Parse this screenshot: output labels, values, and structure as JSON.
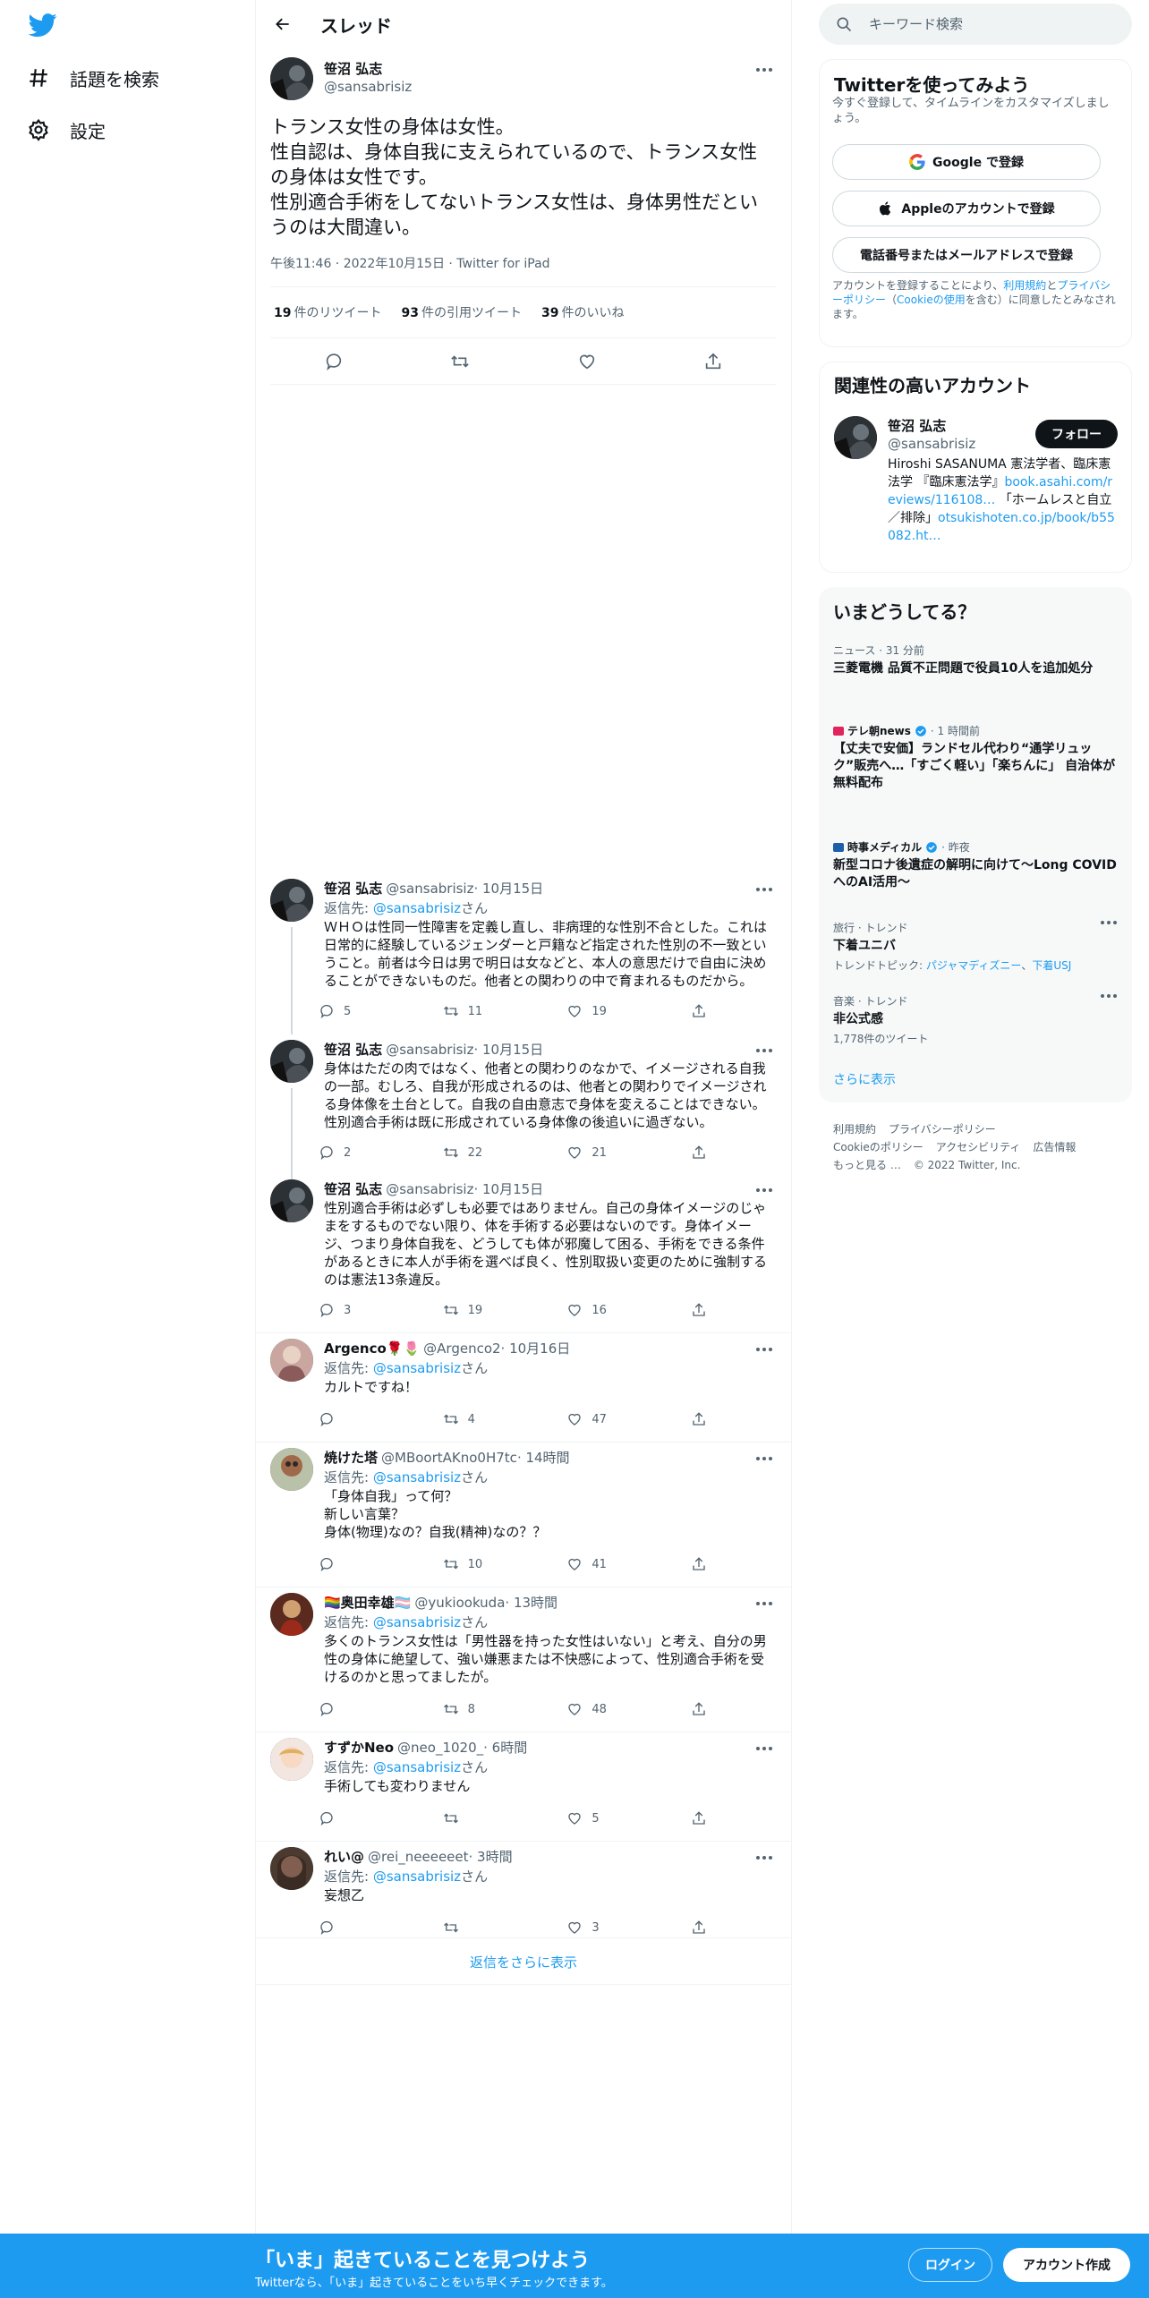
{
  "colors": {
    "brand": "#1d9bf0",
    "text": "#0f1419",
    "muted": "#536471",
    "border": "#eff3f4"
  },
  "nav": {
    "explore": "話題を検索",
    "settings": "設定"
  },
  "header": {
    "title": "スレッド"
  },
  "focal": {
    "name": "笹沼 弘志",
    "handle": "@sansabrisiz",
    "text": "トランス女性の身体は女性。\n性自認は、身体自我に支えられているので、トランス女性の身体は女性です。\n性別適合手術をしてないトランス女性は、身体男性だというのは大間違い。",
    "meta": "午後11:46 · 2022年10月15日 · Twitter for iPad",
    "retweets": "19",
    "retweets_label": "件のリツイート",
    "quotes": "93",
    "quotes_label": "件の引用ツイート",
    "likes": "39",
    "likes_label": "件のいいね"
  },
  "reply_prefix": "返信先: ",
  "reply_suffix": "さん",
  "tweets": [
    {
      "name": "笹沼 弘志",
      "handle": "@sansabrisiz",
      "time": " · 10月15日",
      "reply_to": "@sansabrisiz",
      "text": "ＷＨＯは性同一性障害を定義し直し、非病理的な性別不合とした。これは日常的に経験しているジェンダーと戸籍など指定された性別の不一致ということ。前者は今日は男で明日は女などと、本人の意思だけで自由に決めることができないものだ。他者との関わりの中で育まれるものだから。",
      "replies": "5",
      "retweets": "11",
      "likes": "19"
    },
    {
      "name": "笹沼 弘志",
      "handle": "@sansabrisiz",
      "time": " · 10月15日",
      "text": "身体はただの肉ではなく、他者との関わりのなかで、イメージされる自我の一部。むしろ、自我が形成されるのは、他者との関わりでイメージされる身体像を土台として。自我の自由意志で身体を変えることはできない。性別適合手術は既に形成されている身体像の後追いに過ぎない。",
      "replies": "2",
      "retweets": "22",
      "likes": "21"
    },
    {
      "name": "笹沼 弘志",
      "handle": "@sansabrisiz",
      "time": " · 10月15日",
      "text": "性別適合手術は必ずしも必要ではありません。自己の身体イメージのじゃまをするものでない限り、体を手術する必要はないのです。身体イメージ、つまり身体自我を、どうしても体が邪魔して困る、手術をできる条件があるときに本人が手術を選べば良く、性別取扱い変更のために強制するのは憲法13条違反。",
      "replies": "3",
      "retweets": "19",
      "likes": "16"
    },
    {
      "name": "Argenco🌹🌷",
      "handle": "@Argenco2",
      "time": " · 10月16日",
      "reply_to": "@sansabrisiz",
      "text": "カルトですね！",
      "replies": "",
      "retweets": "4",
      "likes": "47"
    },
    {
      "name": "焼けた塔",
      "handle": "@MBoortAKno0H7tc",
      "time": " · 14時間",
      "reply_to": "@sansabrisiz",
      "text": "「身体自我」って何？\n新しい言葉？\n身体(物理)なの？自我(精神)なの？？",
      "replies": "",
      "retweets": "10",
      "likes": "41"
    },
    {
      "name": "🏳️‍🌈奥田幸雄🏳️‍⚧️",
      "handle": "@yukiookuda",
      "time": " · 13時間",
      "reply_to": "@sansabrisiz",
      "text": "多くのトランス女性は「男性器を持った女性はいない」と考え、自分の男性の身体に絶望して、強い嫌悪または不快感によって、性別適合手術を受けるのかと思ってましたが。",
      "replies": "",
      "retweets": "8",
      "likes": "48"
    },
    {
      "name": "すずかNeo",
      "handle": "@neo_1020_",
      "time": " · 6時間",
      "reply_to": "@sansabrisiz",
      "text": "手術しても変わりません",
      "replies": "",
      "retweets": "",
      "likes": "5"
    },
    {
      "name": "れい@",
      "handle": "@rei_neeeeeet",
      "time": " · 3時間",
      "reply_to": "@sansabrisiz",
      "text": "妄想乙",
      "replies": "",
      "retweets": "",
      "likes": "3"
    }
  ],
  "show_more_replies": "返信をさらに表示",
  "search": {
    "placeholder": "キーワード検索"
  },
  "signup": {
    "title": "Twitterを使ってみよう",
    "subtitle": "今すぐ登録して、タイムラインをカスタマイズしましょう。",
    "google": "Google で登録",
    "apple": "Appleのアカウントで登録",
    "phone": "電話番号またはメールアドレスで登録",
    "terms_1": "アカウントを登録することにより、",
    "terms_link1": "利用規約",
    "terms_2": "と",
    "terms_link2": "プライバシーポリシー",
    "terms_3": "（",
    "terms_link3": "Cookieの使用",
    "terms_4": "を含む）に同意したとみなされます。"
  },
  "related": {
    "title": "関連性の高いアカウント",
    "name": "笹沼 弘志",
    "handle": "@sansabrisiz",
    "follow": "フォロー",
    "bio_1": "Hiroshi SASANUMA 憲法学者、臨床憲法学 『臨床憲法学』",
    "bio_link1": "book.asahi.com/reviews/116108…",
    "bio_2": " 「ホームレスと自立／排除」",
    "bio_link2": "otsukishoten.co.jp/book/b55082.ht…"
  },
  "trends": {
    "title": "いまどうしてる？",
    "items": [
      {
        "ctx": "ニュース · 31 分前",
        "title": "三菱電機 品質不正問題で役員10人を追加処分"
      },
      {
        "source": "テレ朝news",
        "time": " · 1 時間前",
        "title": "【丈夫で安価】ランドセル代わり“通学リュック”販売へ…「すごく軽い」「楽ちんに」 自治体が無料配布"
      },
      {
        "source": "時事メディカル",
        "time": " · 昨夜",
        "title": "新型コロナ後遺症の解明に向けて～Long COVIDへのAI活用～"
      },
      {
        "ctx": "旅行 · トレンド",
        "title": "下着ユニバ",
        "sub_1": "トレンドトピック: ",
        "sub_link1": "パジャマディズニー",
        "sub_sep": "、",
        "sub_link2": "下着USJ"
      },
      {
        "ctx": "音楽 · トレンド",
        "title": "非公式感",
        "sub": "1,778件のツイート"
      }
    ],
    "show_more": "さらに表示"
  },
  "footer": {
    "links": [
      "利用規約",
      "プライバシーポリシー",
      "Cookieのポリシー",
      "アクセシビリティ",
      "広告情報",
      "もっと見る …"
    ],
    "copyright": "© 2022 Twitter, Inc."
  },
  "banner": {
    "title": "「いま」起きていることを見つけよう",
    "subtitle": "Twitterなら、「いま」起きていることをいち早くチェックできます。",
    "login": "ログイン",
    "signup": "アカウント作成"
  }
}
